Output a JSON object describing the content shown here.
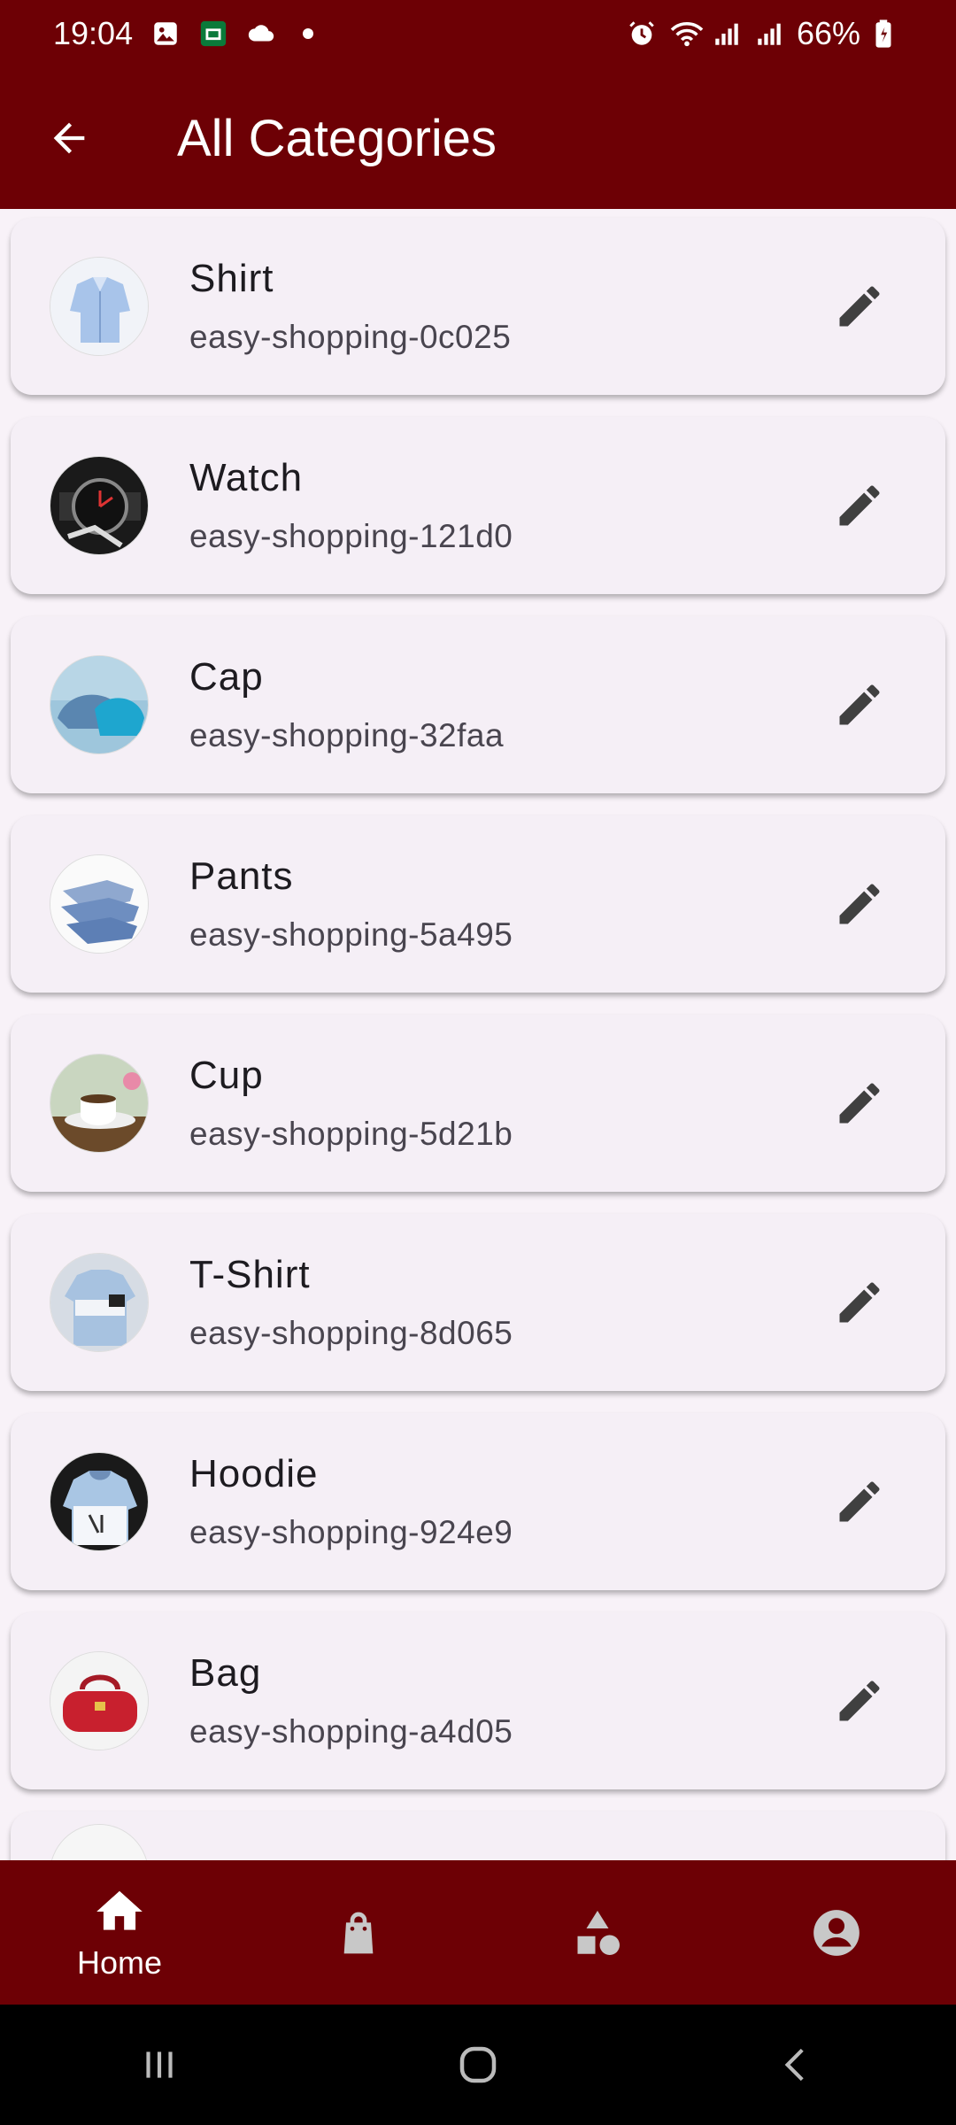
{
  "status_bar": {
    "time": "19:04",
    "battery": "66%",
    "left_icons": [
      "gallery-icon",
      "app-icon",
      "cloud-icon"
    ],
    "right_icons": [
      "alarm-icon",
      "wifi-icon",
      "signal-icon",
      "signal-icon",
      "battery-icon"
    ]
  },
  "app_bar": {
    "title": "All Categories",
    "back_icon": "arrow-back-icon"
  },
  "categories": [
    {
      "name": "Shirt",
      "slug": "easy-shopping-0c025",
      "thumb": "shirt"
    },
    {
      "name": "Watch",
      "slug": "easy-shopping-121d0",
      "thumb": "watch"
    },
    {
      "name": "Cap",
      "slug": "easy-shopping-32faa",
      "thumb": "cap"
    },
    {
      "name": "Pants",
      "slug": "easy-shopping-5a495",
      "thumb": "pants"
    },
    {
      "name": "Cup",
      "slug": "easy-shopping-5d21b",
      "thumb": "cup"
    },
    {
      "name": "T-Shirt",
      "slug": "easy-shopping-8d065",
      "thumb": "tshirt"
    },
    {
      "name": "Hoodie",
      "slug": "easy-shopping-924e9",
      "thumb": "hoodie"
    },
    {
      "name": "Bag",
      "slug": "easy-shopping-a4d05",
      "thumb": "bag"
    }
  ],
  "bottom_nav": {
    "items": [
      {
        "label": "Home",
        "icon": "home-icon",
        "active": true
      },
      {
        "label": "",
        "icon": "shopping-bag-icon",
        "active": false
      },
      {
        "label": "",
        "icon": "category-icon",
        "active": false
      },
      {
        "label": "",
        "icon": "account-icon",
        "active": false
      }
    ]
  },
  "colors": {
    "primary": "#6d0005",
    "card_bg": "#f5eff6",
    "background": "#f8f2f8"
  }
}
